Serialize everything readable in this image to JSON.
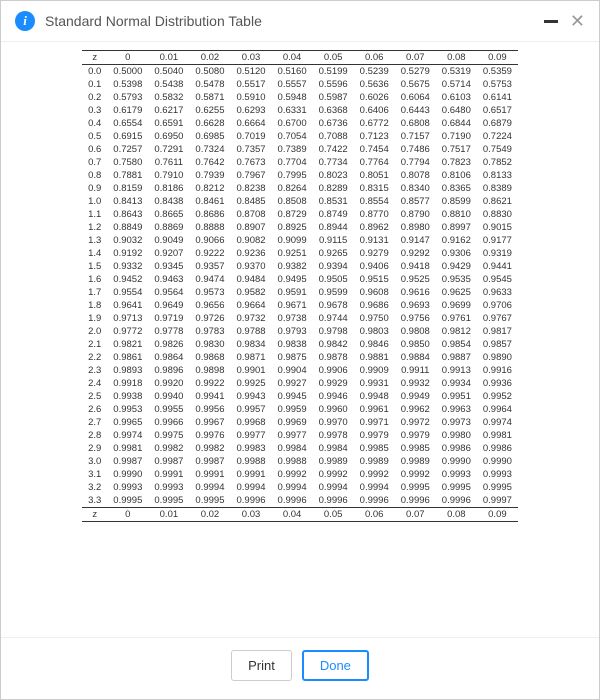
{
  "header": {
    "title": "Standard Normal Distribution Table"
  },
  "columns": [
    "z",
    "0",
    "0.01",
    "0.02",
    "0.03",
    "0.04",
    "0.05",
    "0.06",
    "0.07",
    "0.08",
    "0.09"
  ],
  "rows": [
    {
      "z": "0.0",
      "v": [
        "0.5000",
        "0.5040",
        "0.5080",
        "0.5120",
        "0.5160",
        "0.5199",
        "0.5239",
        "0.5279",
        "0.5319",
        "0.5359"
      ]
    },
    {
      "z": "0.1",
      "v": [
        "0.5398",
        "0.5438",
        "0.5478",
        "0.5517",
        "0.5557",
        "0.5596",
        "0.5636",
        "0.5675",
        "0.5714",
        "0.5753"
      ]
    },
    {
      "z": "0.2",
      "v": [
        "0.5793",
        "0.5832",
        "0.5871",
        "0.5910",
        "0.5948",
        "0.5987",
        "0.6026",
        "0.6064",
        "0.6103",
        "0.6141"
      ]
    },
    {
      "z": "0.3",
      "v": [
        "0.6179",
        "0.6217",
        "0.6255",
        "0.6293",
        "0.6331",
        "0.6368",
        "0.6406",
        "0.6443",
        "0.6480",
        "0.6517"
      ]
    },
    {
      "z": "0.4",
      "v": [
        "0.6554",
        "0.6591",
        "0.6628",
        "0.6664",
        "0.6700",
        "0.6736",
        "0.6772",
        "0.6808",
        "0.6844",
        "0.6879"
      ]
    },
    {
      "z": "0.5",
      "v": [
        "0.6915",
        "0.6950",
        "0.6985",
        "0.7019",
        "0.7054",
        "0.7088",
        "0.7123",
        "0.7157",
        "0.7190",
        "0.7224"
      ]
    },
    {
      "z": "0.6",
      "v": [
        "0.7257",
        "0.7291",
        "0.7324",
        "0.7357",
        "0.7389",
        "0.7422",
        "0.7454",
        "0.7486",
        "0.7517",
        "0.7549"
      ]
    },
    {
      "z": "0.7",
      "v": [
        "0.7580",
        "0.7611",
        "0.7642",
        "0.7673",
        "0.7704",
        "0.7734",
        "0.7764",
        "0.7794",
        "0.7823",
        "0.7852"
      ]
    },
    {
      "z": "0.8",
      "v": [
        "0.7881",
        "0.7910",
        "0.7939",
        "0.7967",
        "0.7995",
        "0.8023",
        "0.8051",
        "0.8078",
        "0.8106",
        "0.8133"
      ]
    },
    {
      "z": "0.9",
      "v": [
        "0.8159",
        "0.8186",
        "0.8212",
        "0.8238",
        "0.8264",
        "0.8289",
        "0.8315",
        "0.8340",
        "0.8365",
        "0.8389"
      ]
    },
    {
      "z": "1.0",
      "v": [
        "0.8413",
        "0.8438",
        "0.8461",
        "0.8485",
        "0.8508",
        "0.8531",
        "0.8554",
        "0.8577",
        "0.8599",
        "0.8621"
      ]
    },
    {
      "z": "1.1",
      "v": [
        "0.8643",
        "0.8665",
        "0.8686",
        "0.8708",
        "0.8729",
        "0.8749",
        "0.8770",
        "0.8790",
        "0.8810",
        "0.8830"
      ]
    },
    {
      "z": "1.2",
      "v": [
        "0.8849",
        "0.8869",
        "0.8888",
        "0.8907",
        "0.8925",
        "0.8944",
        "0.8962",
        "0.8980",
        "0.8997",
        "0.9015"
      ]
    },
    {
      "z": "1.3",
      "v": [
        "0.9032",
        "0.9049",
        "0.9066",
        "0.9082",
        "0.9099",
        "0.9115",
        "0.9131",
        "0.9147",
        "0.9162",
        "0.9177"
      ]
    },
    {
      "z": "1.4",
      "v": [
        "0.9192",
        "0.9207",
        "0.9222",
        "0.9236",
        "0.9251",
        "0.9265",
        "0.9279",
        "0.9292",
        "0.9306",
        "0.9319"
      ]
    },
    {
      "z": "1.5",
      "v": [
        "0.9332",
        "0.9345",
        "0.9357",
        "0.9370",
        "0.9382",
        "0.9394",
        "0.9406",
        "0.9418",
        "0.9429",
        "0.9441"
      ]
    },
    {
      "z": "1.6",
      "v": [
        "0.9452",
        "0.9463",
        "0.9474",
        "0.9484",
        "0.9495",
        "0.9505",
        "0.9515",
        "0.9525",
        "0.9535",
        "0.9545"
      ]
    },
    {
      "z": "1.7",
      "v": [
        "0.9554",
        "0.9564",
        "0.9573",
        "0.9582",
        "0.9591",
        "0.9599",
        "0.9608",
        "0.9616",
        "0.9625",
        "0.9633"
      ]
    },
    {
      "z": "1.8",
      "v": [
        "0.9641",
        "0.9649",
        "0.9656",
        "0.9664",
        "0.9671",
        "0.9678",
        "0.9686",
        "0.9693",
        "0.9699",
        "0.9706"
      ]
    },
    {
      "z": "1.9",
      "v": [
        "0.9713",
        "0.9719",
        "0.9726",
        "0.9732",
        "0.9738",
        "0.9744",
        "0.9750",
        "0.9756",
        "0.9761",
        "0.9767"
      ]
    },
    {
      "z": "2.0",
      "v": [
        "0.9772",
        "0.9778",
        "0.9783",
        "0.9788",
        "0.9793",
        "0.9798",
        "0.9803",
        "0.9808",
        "0.9812",
        "0.9817"
      ]
    },
    {
      "z": "2.1",
      "v": [
        "0.9821",
        "0.9826",
        "0.9830",
        "0.9834",
        "0.9838",
        "0.9842",
        "0.9846",
        "0.9850",
        "0.9854",
        "0.9857"
      ]
    },
    {
      "z": "2.2",
      "v": [
        "0.9861",
        "0.9864",
        "0.9868",
        "0.9871",
        "0.9875",
        "0.9878",
        "0.9881",
        "0.9884",
        "0.9887",
        "0.9890"
      ]
    },
    {
      "z": "2.3",
      "v": [
        "0.9893",
        "0.9896",
        "0.9898",
        "0.9901",
        "0.9904",
        "0.9906",
        "0.9909",
        "0.9911",
        "0.9913",
        "0.9916"
      ]
    },
    {
      "z": "2.4",
      "v": [
        "0.9918",
        "0.9920",
        "0.9922",
        "0.9925",
        "0.9927",
        "0.9929",
        "0.9931",
        "0.9932",
        "0.9934",
        "0.9936"
      ]
    },
    {
      "z": "2.5",
      "v": [
        "0.9938",
        "0.9940",
        "0.9941",
        "0.9943",
        "0.9945",
        "0.9946",
        "0.9948",
        "0.9949",
        "0.9951",
        "0.9952"
      ]
    },
    {
      "z": "2.6",
      "v": [
        "0.9953",
        "0.9955",
        "0.9956",
        "0.9957",
        "0.9959",
        "0.9960",
        "0.9961",
        "0.9962",
        "0.9963",
        "0.9964"
      ]
    },
    {
      "z": "2.7",
      "v": [
        "0.9965",
        "0.9966",
        "0.9967",
        "0.9968",
        "0.9969",
        "0.9970",
        "0.9971",
        "0.9972",
        "0.9973",
        "0.9974"
      ]
    },
    {
      "z": "2.8",
      "v": [
        "0.9974",
        "0.9975",
        "0.9976",
        "0.9977",
        "0.9977",
        "0.9978",
        "0.9979",
        "0.9979",
        "0.9980",
        "0.9981"
      ]
    },
    {
      "z": "2.9",
      "v": [
        "0.9981",
        "0.9982",
        "0.9982",
        "0.9983",
        "0.9984",
        "0.9984",
        "0.9985",
        "0.9985",
        "0.9986",
        "0.9986"
      ]
    },
    {
      "z": "3.0",
      "v": [
        "0.9987",
        "0.9987",
        "0.9987",
        "0.9988",
        "0.9988",
        "0.9989",
        "0.9989",
        "0.9989",
        "0.9990",
        "0.9990"
      ]
    },
    {
      "z": "3.1",
      "v": [
        "0.9990",
        "0.9991",
        "0.9991",
        "0.9991",
        "0.9992",
        "0.9992",
        "0.9992",
        "0.9992",
        "0.9993",
        "0.9993"
      ]
    },
    {
      "z": "3.2",
      "v": [
        "0.9993",
        "0.9993",
        "0.9994",
        "0.9994",
        "0.9994",
        "0.9994",
        "0.9994",
        "0.9995",
        "0.9995",
        "0.9995"
      ]
    },
    {
      "z": "3.3",
      "v": [
        "0.9995",
        "0.9995",
        "0.9995",
        "0.9996",
        "0.9996",
        "0.9996",
        "0.9996",
        "0.9996",
        "0.9996",
        "0.9997"
      ]
    }
  ],
  "footer": {
    "print_label": "Print",
    "done_label": "Done"
  }
}
